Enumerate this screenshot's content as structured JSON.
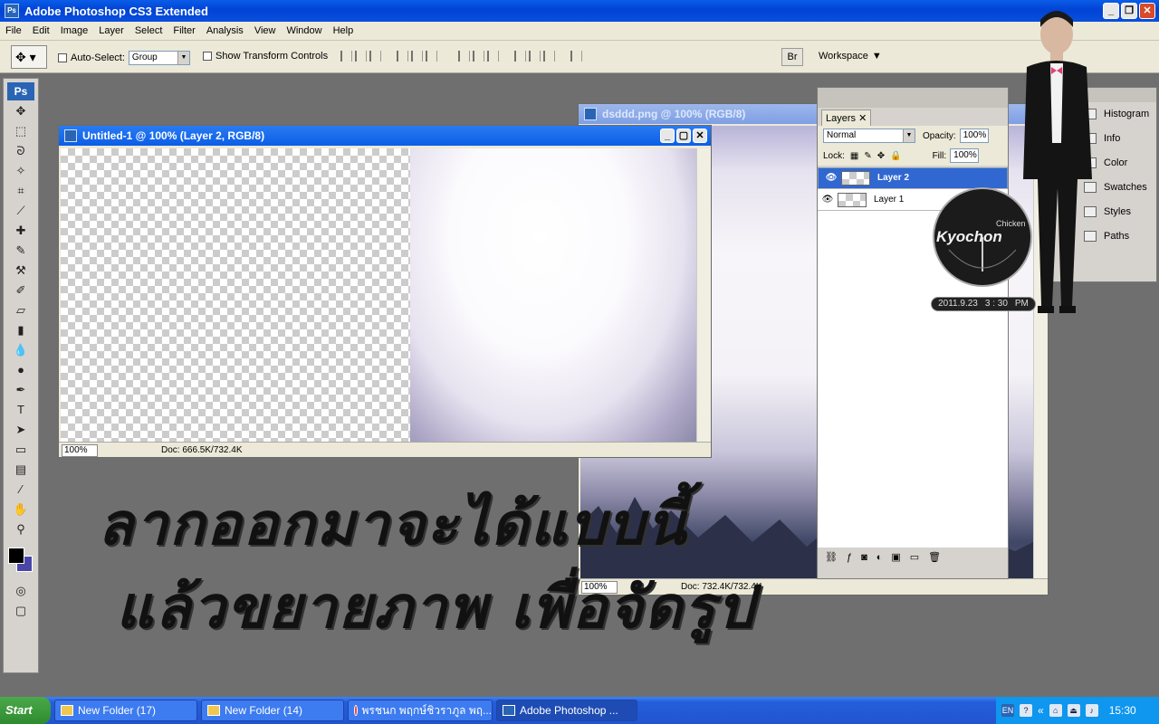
{
  "app": {
    "title": "Adobe Photoshop CS3 Extended",
    "icon": "photoshop-icon",
    "window_controls": [
      "_",
      "❐",
      "✕"
    ]
  },
  "menu": [
    "File",
    "Edit",
    "Image",
    "Layer",
    "Select",
    "Filter",
    "Analysis",
    "View",
    "Window",
    "Help"
  ],
  "options": {
    "auto_select_label": "Auto-Select:",
    "auto_select_value": "Group",
    "show_transform_label": "Show Transform Controls",
    "workspace_label": "Workspace"
  },
  "tools": {
    "logo": "Ps",
    "items": [
      "move-tool",
      "marquee-tool",
      "lasso-tool",
      "magic-wand-tool",
      "crop-tool",
      "slice-tool",
      "healing-brush-tool",
      "brush-tool",
      "clone-stamp-tool",
      "history-brush-tool",
      "eraser-tool",
      "gradient-tool",
      "blur-tool",
      "dodge-tool",
      "pen-tool",
      "type-tool",
      "path-selection-tool",
      "shape-tool",
      "notes-tool",
      "eyedropper-tool",
      "hand-tool",
      "zoom-tool"
    ],
    "foreground_color": "#000000",
    "background_color": "#4a46a8"
  },
  "doc1": {
    "title": "Untitled-1 @ 100% (Layer 2, RGB/8)",
    "zoom": "100%",
    "doc_info": "Doc: 666.5K/732.4K"
  },
  "doc2": {
    "title": "dsddd.png @ 100% (RGB/8)",
    "zoom": "100%",
    "doc_info": "Doc: 732.4K/732.4K"
  },
  "layers_panel": {
    "tab": "Layers",
    "blend_mode": "Normal",
    "opacity_label": "Opacity:",
    "opacity_value": "100%",
    "lock_label": "Lock:",
    "fill_label": "Fill:",
    "fill_value": "100%",
    "layers": [
      {
        "name": "Layer 2",
        "selected": true
      },
      {
        "name": "Layer 1",
        "selected": false
      }
    ]
  },
  "right_panel": [
    "Histogram",
    "Info",
    "Color",
    "Swatches",
    "Styles",
    "Paths"
  ],
  "widget": {
    "brand": "Chicken",
    "logo_text": "Kyochon",
    "date": "2011.9.23",
    "time": "3 : 30",
    "ampm": "PM"
  },
  "overlay_text": {
    "line1": "ลากออกมาจะได้แบบนี้",
    "line2": "แล้วขยายภาพ เพื่อจัดรูป"
  },
  "taskbar": {
    "start": "Start",
    "tasks": [
      {
        "label": "New Folder (17)",
        "icon": "folder-icon"
      },
      {
        "label": "New Folder (14)",
        "icon": "folder-icon"
      },
      {
        "label": "พรชนก พฤกษ์ชิวราภูล พฤ...",
        "icon": "chrome-icon"
      },
      {
        "label": "Adobe Photoshop ...",
        "icon": "photoshop-icon"
      }
    ],
    "language": "EN",
    "clock": "15:30"
  }
}
